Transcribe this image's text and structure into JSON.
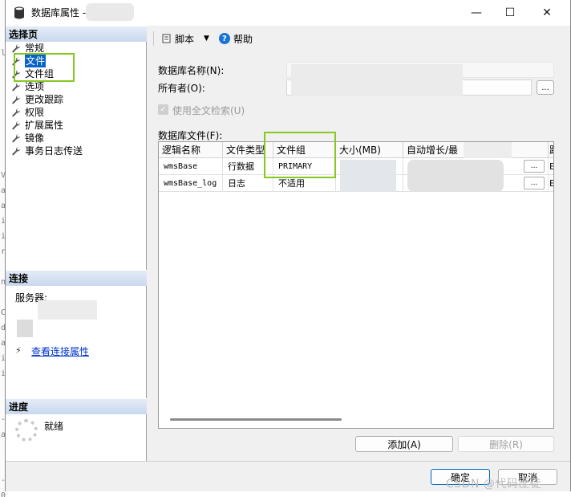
{
  "window": {
    "title": "数据库属性 -",
    "controls": {
      "minimize": "—",
      "maximize": "☐",
      "close": "✕"
    }
  },
  "left_panel": {
    "select_page_header": "选择页",
    "pages": [
      {
        "label": "常规",
        "icon": "wrench-icon",
        "selected": false
      },
      {
        "label": "文件",
        "icon": "wrench-icon",
        "selected": true
      },
      {
        "label": "文件组",
        "icon": "wrench-icon",
        "selected": false
      },
      {
        "label": "选项",
        "icon": "wrench-icon",
        "selected": false
      },
      {
        "label": "更改跟踪",
        "icon": "wrench-icon",
        "selected": false
      },
      {
        "label": "权限",
        "icon": "wrench-icon",
        "selected": false
      },
      {
        "label": "扩展属性",
        "icon": "wrench-icon",
        "selected": false
      },
      {
        "label": "镜像",
        "icon": "wrench-icon",
        "selected": false
      },
      {
        "label": "事务日志传送",
        "icon": "wrench-icon",
        "selected": false
      }
    ],
    "connection_header": "连接",
    "server_label": "服务器:",
    "view_connection_link": "查看连接属性",
    "progress_header": "进度",
    "progress_status": "就绪"
  },
  "toolbar": {
    "script_label": "脚本",
    "help_label": "帮助"
  },
  "form": {
    "db_name_label": "数据库名称(N):",
    "owner_label": "所有者(O):",
    "owner_browse_label": "...",
    "fulltext_label": "使用全文检索(U)",
    "files_label": "数据库文件(F):"
  },
  "files_grid": {
    "columns": [
      "逻辑名称",
      "文件类型",
      "文件组",
      "大小(MB)",
      "自动增长/最",
      "路"
    ],
    "rows": [
      {
        "logical_name": "wmsBase",
        "file_type": "行数据",
        "filegroup": "PRIMARY",
        "browse": "...",
        "path": "E"
      },
      {
        "logical_name": "wmsBase_log",
        "file_type": "日志",
        "filegroup": "不适用",
        "browse": "...",
        "path": "E"
      }
    ]
  },
  "buttons": {
    "add": "添加(A)",
    "remove": "删除(R)",
    "ok": "确定",
    "cancel": "取消"
  },
  "watermark": "CSDN @代码匪徒",
  "colors": {
    "highlight_box": "#86c820",
    "selection": "#0a64c8",
    "link": "#0033cc",
    "help_icon": "#1a73d6"
  },
  "bg_editor_glyphs": [
    "",
    "",
    "",
    "l",
    "",
    "",
    "",
    "",
    "",
    "",
    "",
    "V",
    "a",
    "a",
    "i",
    "i",
    "r",
    "",
    "n",
    "",
    "C",
    "d",
    "a",
    "i",
    "i",
    "",
    "",
    "-",
    "a",
    "",
    "",
    "-",
    "0"
  ]
}
